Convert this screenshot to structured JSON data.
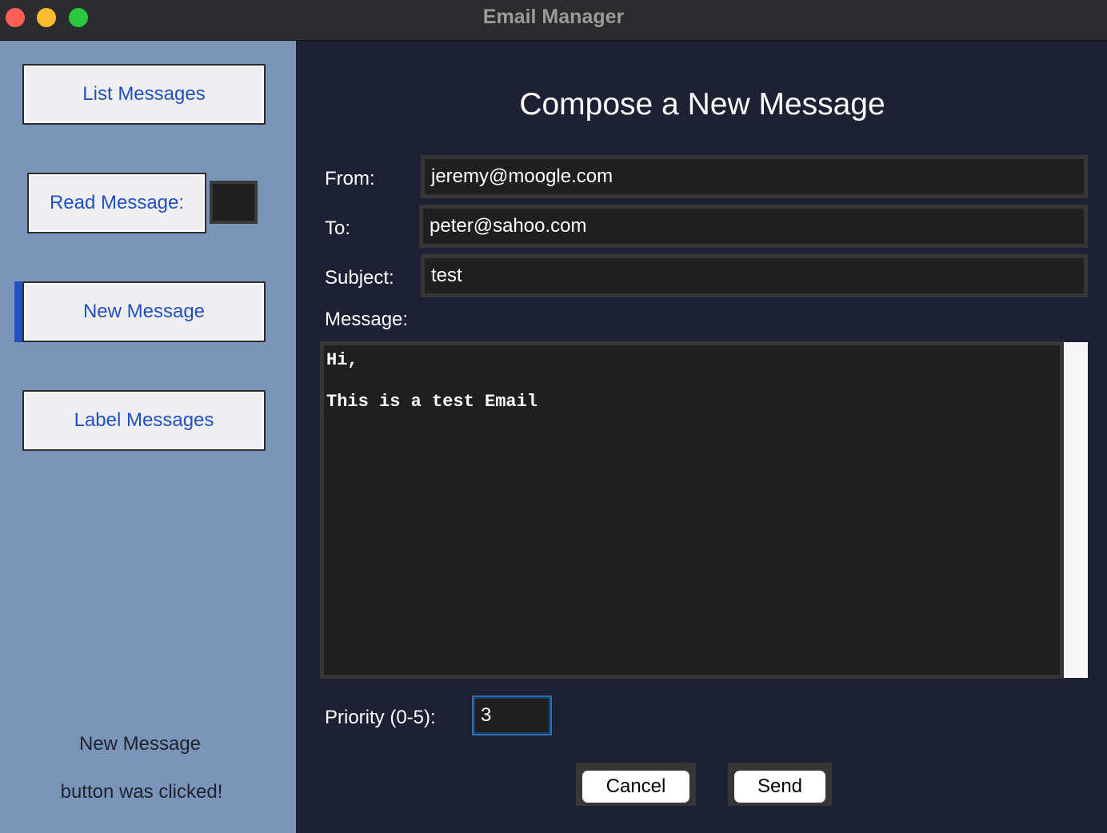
{
  "window": {
    "title": "Email Manager"
  },
  "sidebar": {
    "list_label": "List Messages",
    "read_label": "Read Message:",
    "read_value": "",
    "new_label": "New Message",
    "label_label": "Label Messages",
    "status_line1": "New Message",
    "status_line2": "button was clicked!"
  },
  "compose": {
    "heading": "Compose a New Message",
    "from_label": "From:",
    "from_value": "jeremy@moogle.com",
    "to_label": "To:",
    "to_value": "peter@sahoo.com",
    "subject_label": "Subject:",
    "subject_value": "test",
    "message_label": "Message:",
    "message_value": "Hi,\n\nThis is a test Email",
    "priority_label": "Priority (0-5):",
    "priority_value": "3",
    "cancel_label": "Cancel",
    "send_label": "Send"
  },
  "colors": {
    "sidebar_bg": "#7a95b8",
    "main_bg": "#1e2033",
    "button_text": "#2250c2",
    "accent": "#2250c2"
  }
}
